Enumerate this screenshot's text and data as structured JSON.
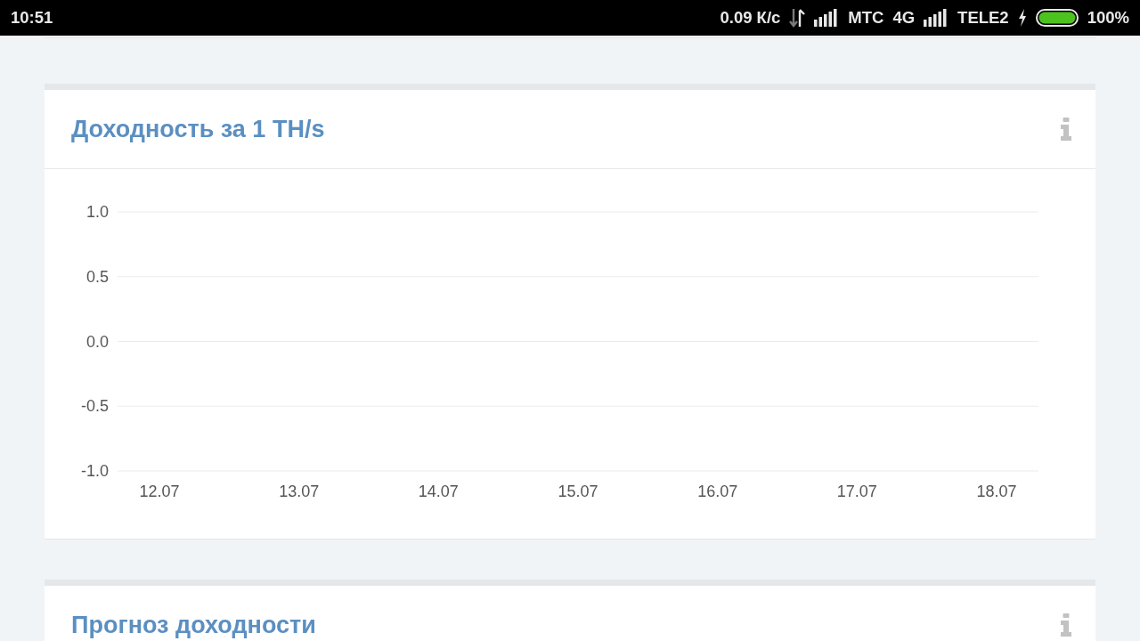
{
  "status_bar": {
    "time": "10:51",
    "network_speed": "0.09 К/с",
    "carrier_1": "МТС",
    "network_type": "4G",
    "carrier_2": "TELE2",
    "battery": "100%"
  },
  "cards": [
    {
      "title": "Доходность за 1 TH/s",
      "chart_data": {
        "type": "line",
        "categories": [
          "12.07",
          "13.07",
          "14.07",
          "15.07",
          "16.07",
          "17.07",
          "18.07"
        ],
        "ylim": [
          -1,
          1
        ],
        "yticks": [
          {
            "value": 1,
            "label": "1.0"
          },
          {
            "value": 0.5,
            "label": "0.5"
          },
          {
            "value": 0,
            "label": "0.0"
          },
          {
            "value": -0.5,
            "label": "-0.5"
          },
          {
            "value": -1,
            "label": "-1.0"
          }
        ],
        "grid": true
      }
    },
    {
      "title": "Прогноз доходности"
    }
  ]
}
